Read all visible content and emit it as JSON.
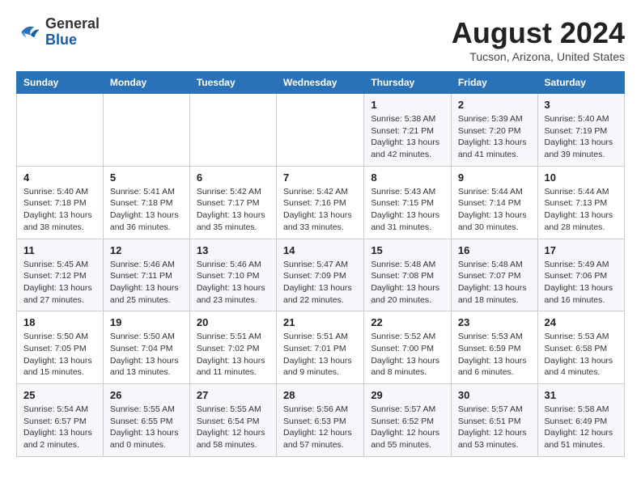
{
  "header": {
    "logo_line1": "General",
    "logo_line2": "Blue",
    "month": "August 2024",
    "location": "Tucson, Arizona, United States"
  },
  "weekdays": [
    "Sunday",
    "Monday",
    "Tuesday",
    "Wednesday",
    "Thursday",
    "Friday",
    "Saturday"
  ],
  "weeks": [
    [
      {
        "day": "",
        "info": ""
      },
      {
        "day": "",
        "info": ""
      },
      {
        "day": "",
        "info": ""
      },
      {
        "day": "",
        "info": ""
      },
      {
        "day": "1",
        "info": "Sunrise: 5:38 AM\nSunset: 7:21 PM\nDaylight: 13 hours\nand 42 minutes."
      },
      {
        "day": "2",
        "info": "Sunrise: 5:39 AM\nSunset: 7:20 PM\nDaylight: 13 hours\nand 41 minutes."
      },
      {
        "day": "3",
        "info": "Sunrise: 5:40 AM\nSunset: 7:19 PM\nDaylight: 13 hours\nand 39 minutes."
      }
    ],
    [
      {
        "day": "4",
        "info": "Sunrise: 5:40 AM\nSunset: 7:18 PM\nDaylight: 13 hours\nand 38 minutes."
      },
      {
        "day": "5",
        "info": "Sunrise: 5:41 AM\nSunset: 7:18 PM\nDaylight: 13 hours\nand 36 minutes."
      },
      {
        "day": "6",
        "info": "Sunrise: 5:42 AM\nSunset: 7:17 PM\nDaylight: 13 hours\nand 35 minutes."
      },
      {
        "day": "7",
        "info": "Sunrise: 5:42 AM\nSunset: 7:16 PM\nDaylight: 13 hours\nand 33 minutes."
      },
      {
        "day": "8",
        "info": "Sunrise: 5:43 AM\nSunset: 7:15 PM\nDaylight: 13 hours\nand 31 minutes."
      },
      {
        "day": "9",
        "info": "Sunrise: 5:44 AM\nSunset: 7:14 PM\nDaylight: 13 hours\nand 30 minutes."
      },
      {
        "day": "10",
        "info": "Sunrise: 5:44 AM\nSunset: 7:13 PM\nDaylight: 13 hours\nand 28 minutes."
      }
    ],
    [
      {
        "day": "11",
        "info": "Sunrise: 5:45 AM\nSunset: 7:12 PM\nDaylight: 13 hours\nand 27 minutes."
      },
      {
        "day": "12",
        "info": "Sunrise: 5:46 AM\nSunset: 7:11 PM\nDaylight: 13 hours\nand 25 minutes."
      },
      {
        "day": "13",
        "info": "Sunrise: 5:46 AM\nSunset: 7:10 PM\nDaylight: 13 hours\nand 23 minutes."
      },
      {
        "day": "14",
        "info": "Sunrise: 5:47 AM\nSunset: 7:09 PM\nDaylight: 13 hours\nand 22 minutes."
      },
      {
        "day": "15",
        "info": "Sunrise: 5:48 AM\nSunset: 7:08 PM\nDaylight: 13 hours\nand 20 minutes."
      },
      {
        "day": "16",
        "info": "Sunrise: 5:48 AM\nSunset: 7:07 PM\nDaylight: 13 hours\nand 18 minutes."
      },
      {
        "day": "17",
        "info": "Sunrise: 5:49 AM\nSunset: 7:06 PM\nDaylight: 13 hours\nand 16 minutes."
      }
    ],
    [
      {
        "day": "18",
        "info": "Sunrise: 5:50 AM\nSunset: 7:05 PM\nDaylight: 13 hours\nand 15 minutes."
      },
      {
        "day": "19",
        "info": "Sunrise: 5:50 AM\nSunset: 7:04 PM\nDaylight: 13 hours\nand 13 minutes."
      },
      {
        "day": "20",
        "info": "Sunrise: 5:51 AM\nSunset: 7:02 PM\nDaylight: 13 hours\nand 11 minutes."
      },
      {
        "day": "21",
        "info": "Sunrise: 5:51 AM\nSunset: 7:01 PM\nDaylight: 13 hours\nand 9 minutes."
      },
      {
        "day": "22",
        "info": "Sunrise: 5:52 AM\nSunset: 7:00 PM\nDaylight: 13 hours\nand 8 minutes."
      },
      {
        "day": "23",
        "info": "Sunrise: 5:53 AM\nSunset: 6:59 PM\nDaylight: 13 hours\nand 6 minutes."
      },
      {
        "day": "24",
        "info": "Sunrise: 5:53 AM\nSunset: 6:58 PM\nDaylight: 13 hours\nand 4 minutes."
      }
    ],
    [
      {
        "day": "25",
        "info": "Sunrise: 5:54 AM\nSunset: 6:57 PM\nDaylight: 13 hours\nand 2 minutes."
      },
      {
        "day": "26",
        "info": "Sunrise: 5:55 AM\nSunset: 6:55 PM\nDaylight: 13 hours\nand 0 minutes."
      },
      {
        "day": "27",
        "info": "Sunrise: 5:55 AM\nSunset: 6:54 PM\nDaylight: 12 hours\nand 58 minutes."
      },
      {
        "day": "28",
        "info": "Sunrise: 5:56 AM\nSunset: 6:53 PM\nDaylight: 12 hours\nand 57 minutes."
      },
      {
        "day": "29",
        "info": "Sunrise: 5:57 AM\nSunset: 6:52 PM\nDaylight: 12 hours\nand 55 minutes."
      },
      {
        "day": "30",
        "info": "Sunrise: 5:57 AM\nSunset: 6:51 PM\nDaylight: 12 hours\nand 53 minutes."
      },
      {
        "day": "31",
        "info": "Sunrise: 5:58 AM\nSunset: 6:49 PM\nDaylight: 12 hours\nand 51 minutes."
      }
    ]
  ]
}
